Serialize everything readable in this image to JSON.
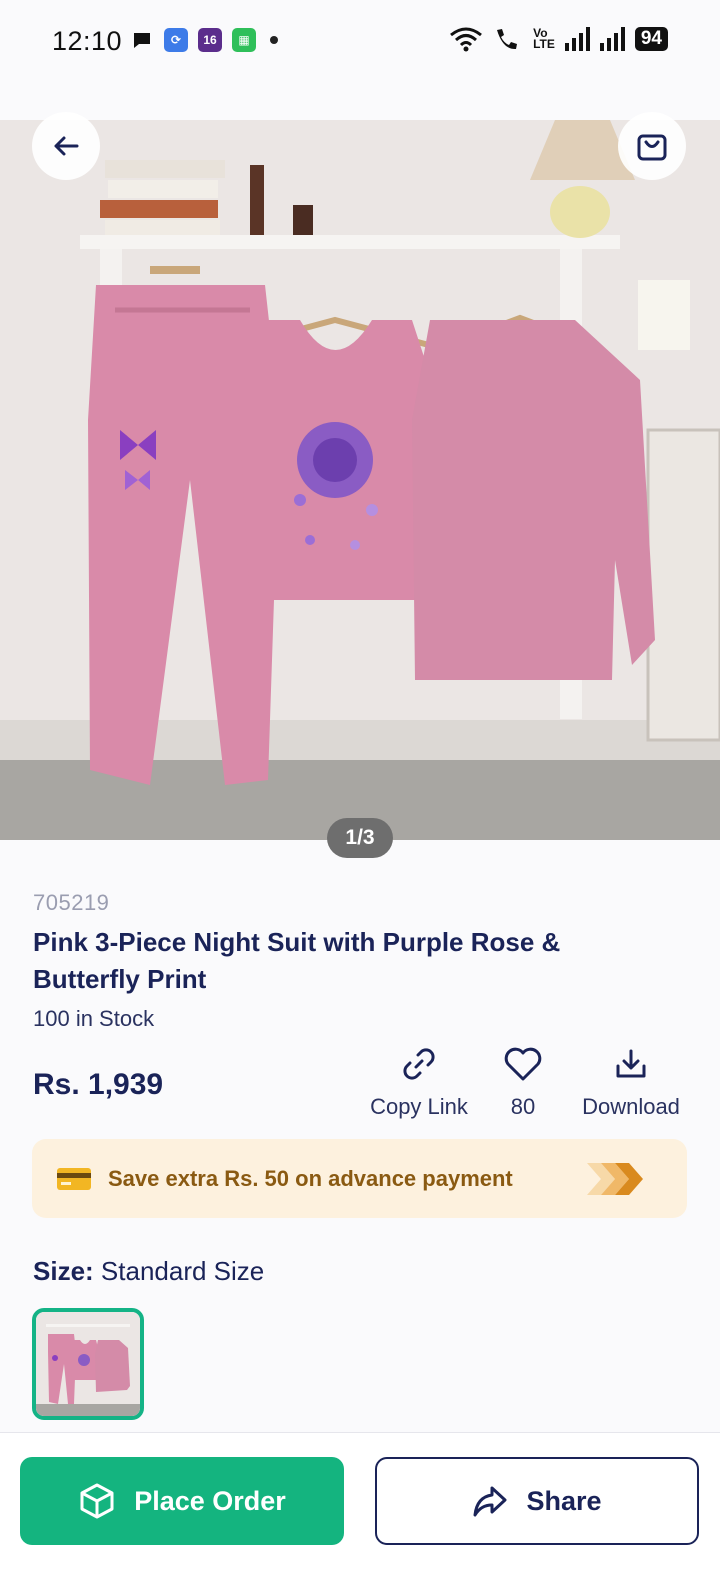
{
  "status_bar": {
    "time": "12:10",
    "notification_icons": [
      "chat-icon",
      "sync-app-icon",
      "calendar-app-icon",
      "grid-app-icon"
    ],
    "calendar_badge": "16",
    "network_label_top": "Vo",
    "network_label_bottom": "LTE",
    "battery": "94"
  },
  "product": {
    "image_pager": "1/3",
    "sku": "705219",
    "title": "Pink 3-Piece Night Suit with Purple Rose & Butterfly Print",
    "stock": "100 in Stock",
    "price": "Rs. 1,939"
  },
  "actions": {
    "copy_link": "Copy Link",
    "favorites_count": "80",
    "download": "Download"
  },
  "promo": {
    "text": "Save extra Rs. 50 on advance payment"
  },
  "size": {
    "label": "Size:",
    "value": "Standard Size"
  },
  "bottom_bar": {
    "place_order": "Place Order",
    "share": "Share"
  },
  "colors": {
    "primary_green": "#14b47f",
    "navy_text": "#1a2358",
    "promo_bg": "#fdf1de",
    "promo_text": "#8a5a12",
    "garment_pink": "#d98aa9"
  }
}
